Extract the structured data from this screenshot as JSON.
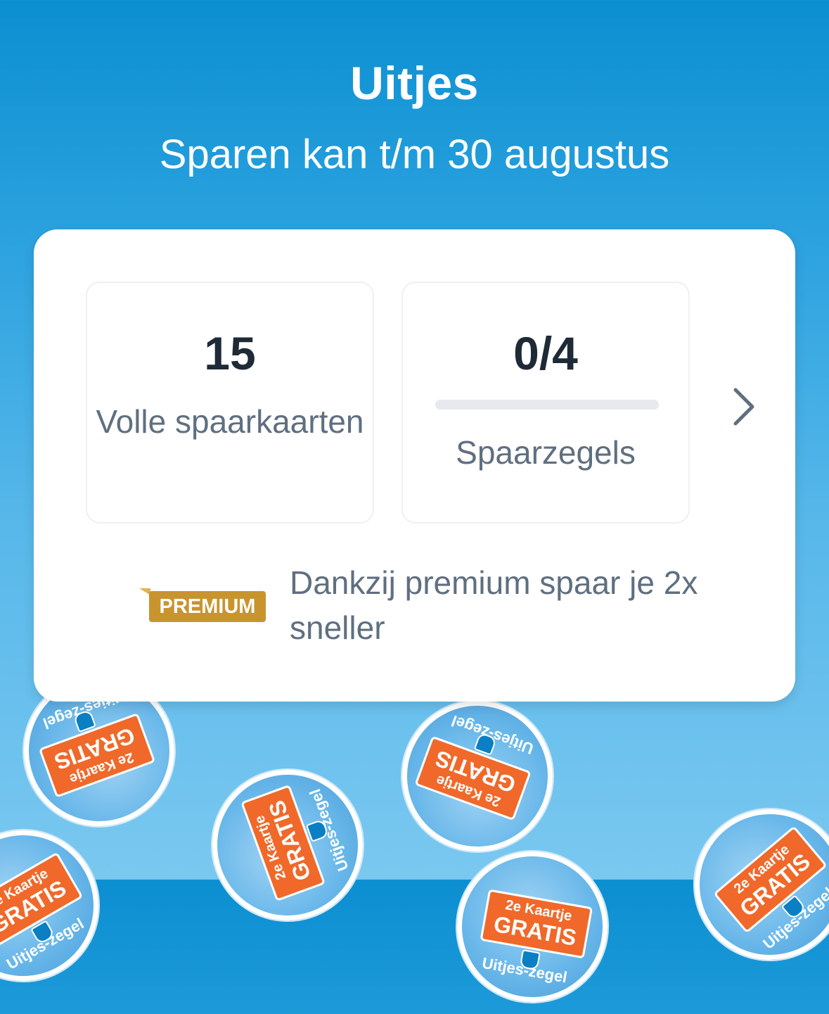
{
  "header": {
    "title": "Uitjes",
    "subtitle": "Sparen kan t/m 30 augustus"
  },
  "stats": {
    "full_cards_value": "15",
    "full_cards_label": "Volle spaarkaarten",
    "stamps_value": "0/4",
    "stamps_label": "Spaarzegels",
    "stamps_progress": 0
  },
  "premium": {
    "badge": "PREMIUM",
    "message": "Dankzij premium spaar je 2x sneller"
  },
  "stickers": {
    "ticket_top": "2e Kaartje",
    "ticket_main": "GRATIS",
    "ring": "Uitjes-zegel"
  },
  "colors": {
    "background_top": "#0b8fd1",
    "background_bottom": "#7ac8f0",
    "premium_gold": "#c8942e",
    "ticket_orange": "#f0692a",
    "text_dark": "#1f2a37",
    "text_muted": "#5f6f80"
  },
  "icons": {
    "chevron": "chevron-right-icon"
  }
}
